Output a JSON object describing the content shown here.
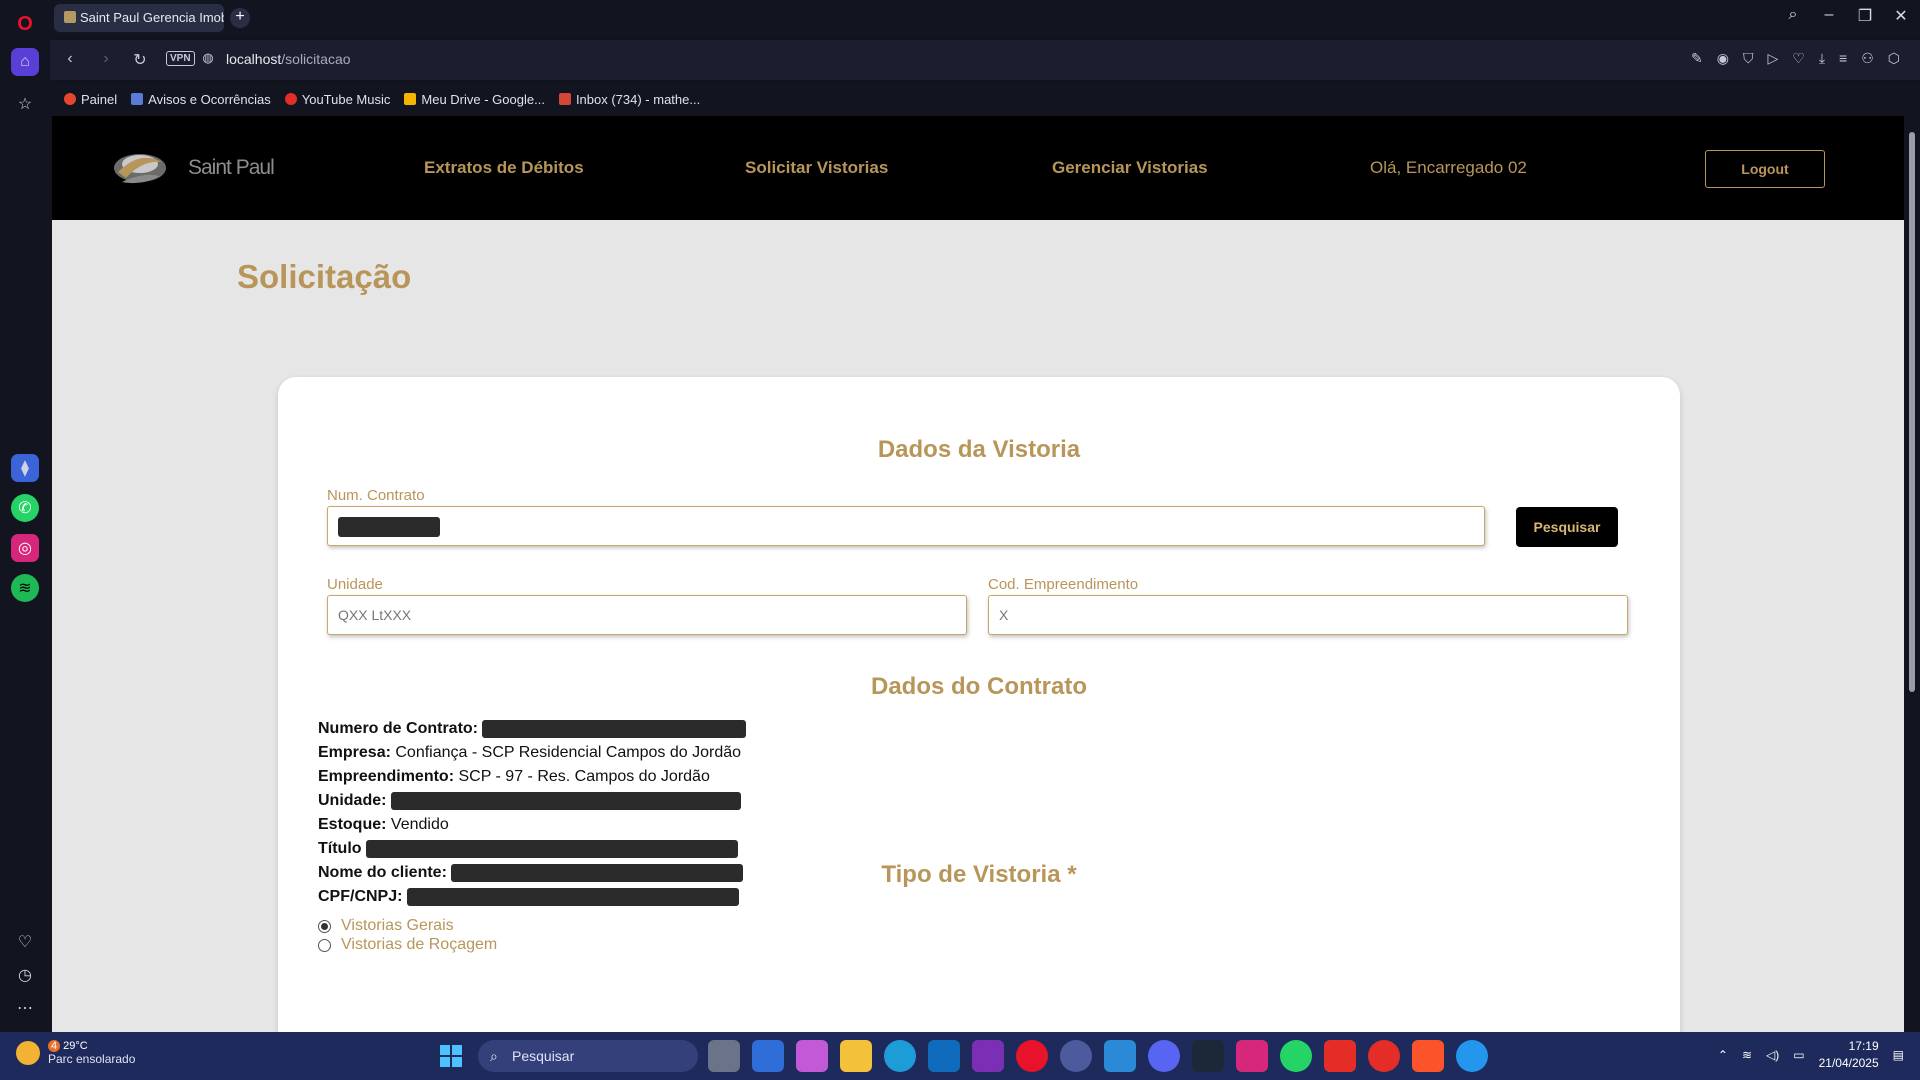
{
  "browser": {
    "tab_title": "Saint Paul Gerencia Imobi",
    "url_host": "localhost",
    "url_path": "/solicitacao",
    "vpn_label": "VPN",
    "bookmarks": [
      {
        "label": "Painel",
        "color": "#e5462f"
      },
      {
        "label": "Avisos e Ocorrências",
        "color": "#5a7bd8"
      },
      {
        "label": "YouTube Music",
        "color": "#e52d27"
      },
      {
        "label": "Meu Drive - Google...",
        "color": "#f4b400"
      },
      {
        "label": "Inbox (734) - mathe...",
        "color": "#d44638"
      }
    ]
  },
  "site": {
    "logo_text": "Saint Paul",
    "nav": {
      "extratos": "Extratos de Débitos",
      "solicitar": "Solicitar Vistorias",
      "gerenciar": "Gerenciar Vistorias"
    },
    "greeting": "Olá, Encarregado 02",
    "logout_label": "Logout"
  },
  "page": {
    "title": "Solicitação",
    "vistoria_section": "Dados da Vistoria",
    "num_contrato_label": "Num. Contrato",
    "pesquisar_label": "Pesquisar",
    "unidade_label": "Unidade",
    "unidade_value": "QXX LtXXX",
    "cod_emp_label": "Cod. Empreendimento",
    "cod_emp_value": "X",
    "contrato_section": "Dados do Contrato",
    "contract_fields": {
      "numero_label": "Numero de Contrato:",
      "empresa_label": "Empresa:",
      "empresa_value": "Confiança - SCP Residencial Campos do Jordão",
      "empreendimento_label": "Empreendimento:",
      "empreendimento_value": "SCP - 97 - Res. Campos do Jordão",
      "unidade_label": "Unidade:",
      "estoque_label": "Estoque:",
      "estoque_value": "Vendido",
      "titulo_label": "Título",
      "cliente_label": "Nome do cliente:",
      "cpf_label": "CPF/CNPJ:"
    },
    "tipo_section": "Tipo de Vistoria *",
    "tipo_options": [
      {
        "label": "Vistorias Gerais",
        "checked": true
      },
      {
        "label": "Vistorias de Roçagem",
        "checked": false
      }
    ]
  },
  "taskbar": {
    "weather_temp": "29°C",
    "weather_desc": "Parc ensolarado",
    "weather_badge": "4",
    "search_label": "Pesquisar",
    "time": "17:19",
    "date": "21/04/2025"
  },
  "colors": {
    "gold": "#b8965a",
    "header": "#000000",
    "background": "#e6e6e6"
  }
}
